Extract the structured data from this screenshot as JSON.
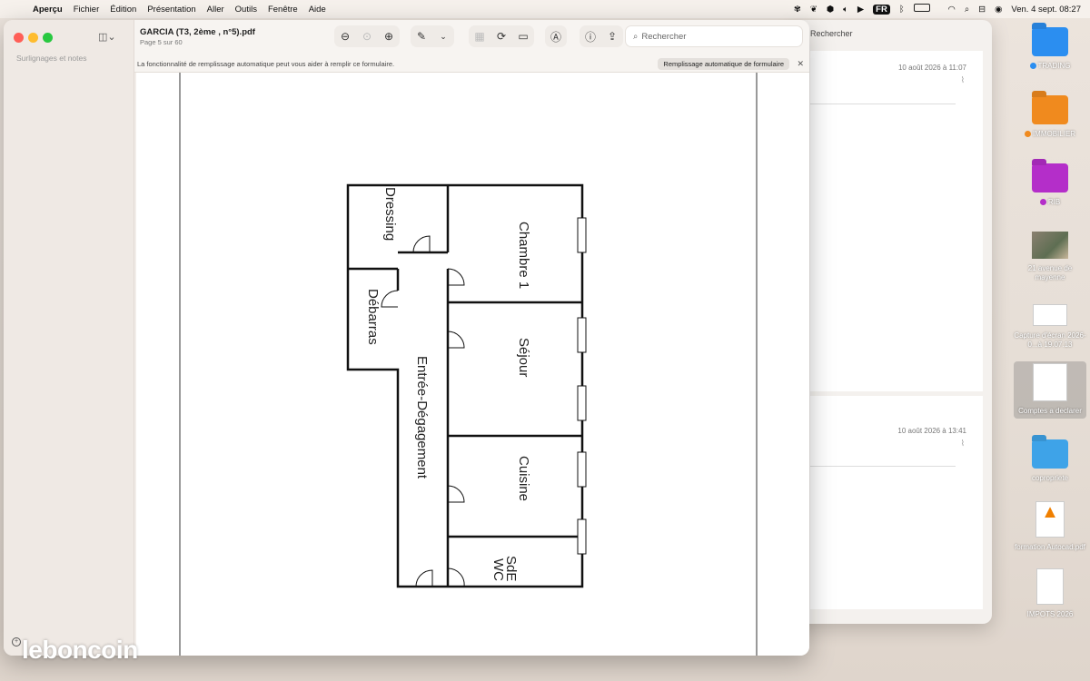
{
  "menubar": {
    "app": "Aperçu",
    "items": [
      "Fichier",
      "Édition",
      "Présentation",
      "Aller",
      "Outils",
      "Fenêtre",
      "Aide"
    ],
    "input_source": "FR",
    "clock": "Ven. 4 sept.  08:27"
  },
  "window": {
    "title": "GARCIA (T3, 2ème , n°5).pdf",
    "page_info": "Page 5 sur 60",
    "sidebar_label": "Surlignages et notes",
    "search_placeholder": "Rechercher"
  },
  "autofill_bar": {
    "message": "La fonctionnalité de remplissage automatique peut vous aider à remplir ce formulaire.",
    "button": "Remplissage automatique de formulaire"
  },
  "floor_plan": {
    "rooms": [
      "Dressing",
      "Chambre 1",
      "Débarras",
      "Séjour",
      "Entrée-Dégagement",
      "Cuisine",
      "SdE",
      "WC"
    ]
  },
  "back_window": {
    "search": "Rechercher",
    "dates": [
      "10 août 2026 à 11:07",
      "10 août 2026 à 13:41"
    ]
  },
  "desktop_icons": [
    {
      "label": "TRADING",
      "color": "#2b8ef0",
      "tag": "#2b8ef0"
    },
    {
      "label": "IMMOBILIER",
      "color": "#f08a1e",
      "tag": "#f08a1e"
    },
    {
      "label": "RIB",
      "color": "#b42ec9",
      "tag": "#b42ec9"
    },
    {
      "label": "21 avenue de mayenne"
    },
    {
      "label": "Capture d'écran 2026-0...à 19.07.13"
    },
    {
      "label": "Comptes a declarer"
    },
    {
      "label": "copropriete",
      "color": "#3ea3e8"
    },
    {
      "label": "formation Autocad.pdf"
    },
    {
      "label": "IMPOTS 2026"
    }
  ],
  "watermark": "leboncoin"
}
